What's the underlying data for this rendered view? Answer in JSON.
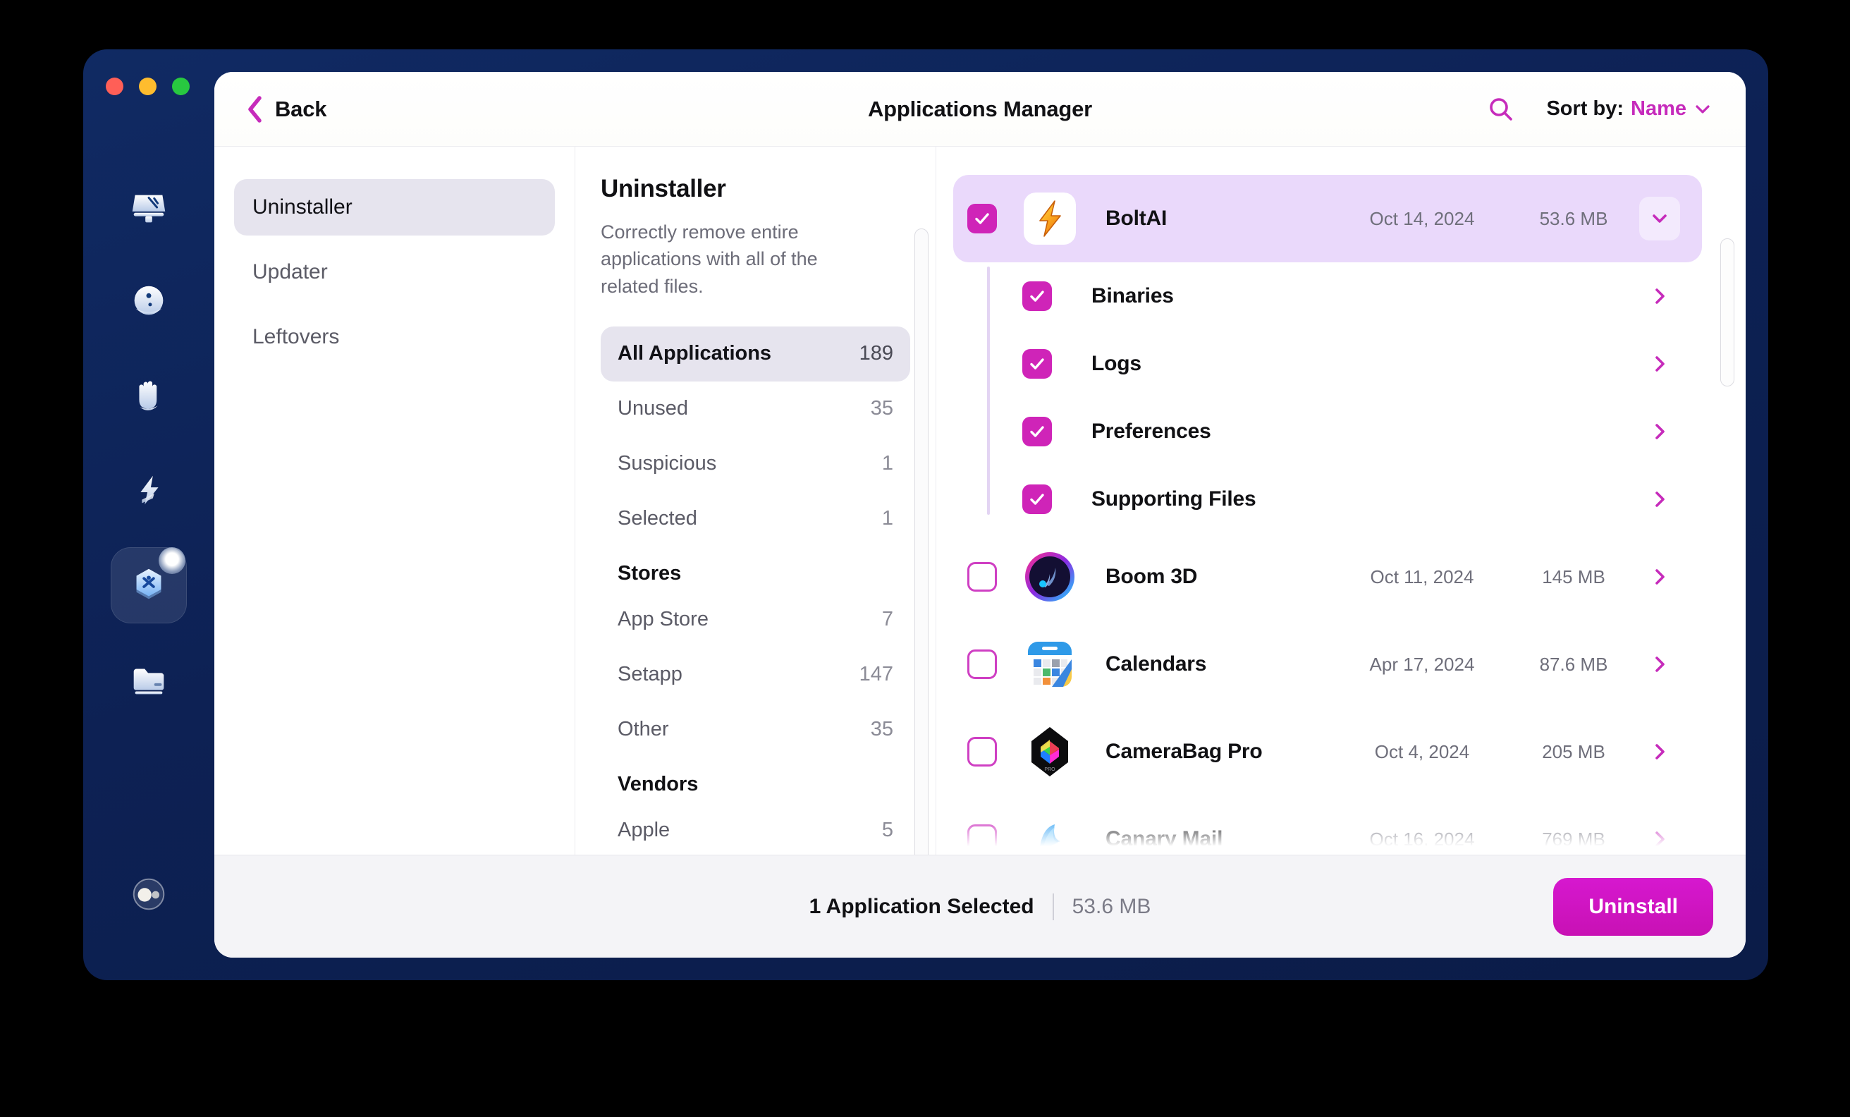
{
  "window": {
    "traffic_lights": [
      "close",
      "minimize",
      "maximize"
    ]
  },
  "dock": {
    "items": [
      {
        "name": "cleanup-display-icon",
        "icon": "monitor-sweep-icon"
      },
      {
        "name": "protection-icon",
        "icon": "face-circle-icon"
      },
      {
        "name": "privacy-hand-icon",
        "icon": "hand-icon"
      },
      {
        "name": "performance-icon",
        "icon": "lightning-bolt-icon"
      },
      {
        "name": "applications-icon",
        "icon": "hexagon-apps-icon",
        "active": true
      },
      {
        "name": "files-icon",
        "icon": "folder-icon"
      },
      {
        "name": "assistant-icon",
        "icon": "bubble-icon"
      }
    ]
  },
  "topbar": {
    "back_label": "Back",
    "title": "Applications Manager",
    "sort_label": "Sort by:",
    "sort_value": "Name"
  },
  "nav": {
    "items": [
      {
        "label": "Uninstaller",
        "active": true
      },
      {
        "label": "Updater",
        "active": false
      },
      {
        "label": "Leftovers",
        "active": false
      }
    ]
  },
  "categories": {
    "title": "Uninstaller",
    "description": "Correctly remove entire applications with all of the related files.",
    "rows": [
      {
        "label": "All Applications",
        "count": "189",
        "active": true,
        "type": "row"
      },
      {
        "label": "Unused",
        "count": "35",
        "active": false,
        "type": "row"
      },
      {
        "label": "Suspicious",
        "count": "1",
        "active": false,
        "type": "row"
      },
      {
        "label": "Selected",
        "count": "1",
        "active": false,
        "type": "row"
      },
      {
        "label": "Stores",
        "count": "",
        "active": false,
        "type": "header"
      },
      {
        "label": "App Store",
        "count": "7",
        "active": false,
        "type": "row"
      },
      {
        "label": "Setapp",
        "count": "147",
        "active": false,
        "type": "row"
      },
      {
        "label": "Other",
        "count": "35",
        "active": false,
        "type": "row"
      },
      {
        "label": "Vendors",
        "count": "",
        "active": false,
        "type": "header"
      },
      {
        "label": "Apple",
        "count": "5",
        "active": false,
        "type": "row"
      }
    ]
  },
  "applications": [
    {
      "name": "BoltAI",
      "date": "Oct 14, 2024",
      "size": "53.6 MB",
      "checked": true,
      "selected": true,
      "expanded": true,
      "icon": "boltai-icon"
    },
    {
      "name": "Boom 3D",
      "date": "Oct 11, 2024",
      "size": "145 MB",
      "checked": false,
      "selected": false,
      "expanded": false,
      "icon": "boom3d-icon"
    },
    {
      "name": "Calendars",
      "date": "Apr 17, 2024",
      "size": "87.6 MB",
      "checked": false,
      "selected": false,
      "expanded": false,
      "icon": "calendars-icon"
    },
    {
      "name": "CameraBag Pro",
      "date": "Oct 4, 2024",
      "size": "205 MB",
      "checked": false,
      "selected": false,
      "expanded": false,
      "icon": "camerabag-icon"
    },
    {
      "name": "Canary Mail",
      "date": "Oct 16, 2024",
      "size": "769 MB",
      "checked": false,
      "selected": false,
      "expanded": false,
      "icon": "canarymail-icon"
    }
  ],
  "sub_items": [
    {
      "label": "Binaries",
      "checked": true
    },
    {
      "label": "Logs",
      "checked": true
    },
    {
      "label": "Preferences",
      "checked": true
    },
    {
      "label": "Supporting Files",
      "checked": true
    }
  ],
  "bottombar": {
    "selected_text": "1 Application Selected",
    "selected_size": "53.6 MB",
    "uninstall_label": "Uninstall"
  },
  "colors": {
    "accent_magenta": "#c62bbb",
    "checkbox_on": "#cf24b8",
    "selected_row": "#ead9fb",
    "nav_active": "#e6e4ee",
    "window_blue": "#0d2154",
    "uninstall_button": "#d618cf"
  }
}
